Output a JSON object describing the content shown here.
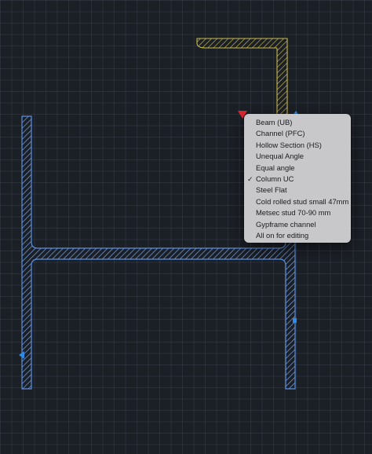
{
  "colors": {
    "background": "#1b1f26",
    "i_section_stroke": "#5b8fe0",
    "angle_stroke": "#c9b94a",
    "marker_red": "#e0262f",
    "marker_blue": "#2f8ae8",
    "menu_background": "#c8c8ca",
    "menu_text": "#1c1c1e"
  },
  "markers": {
    "insertion_point_icon": "red-triangle",
    "grip_icon": "blue-triangle",
    "snap_point_icon": "blue-square"
  },
  "section_menu": {
    "items": [
      {
        "label": "Beam (UB)",
        "checked": false
      },
      {
        "label": "Channel (PFC)",
        "checked": false
      },
      {
        "label": "Hollow Section (HS)",
        "checked": false
      },
      {
        "label": "Unequal Angle",
        "checked": false
      },
      {
        "label": "Equal angle",
        "checked": false
      },
      {
        "label": "Column UC",
        "checked": true
      },
      {
        "label": "Steel Flat",
        "checked": false
      },
      {
        "label": "Cold rolled stud small 47mm",
        "checked": false
      },
      {
        "label": "Metsec stud 70-90 mm",
        "checked": false
      },
      {
        "label": "Gypframe channel",
        "checked": false
      },
      {
        "label": "All on for editing",
        "checked": false
      }
    ]
  }
}
